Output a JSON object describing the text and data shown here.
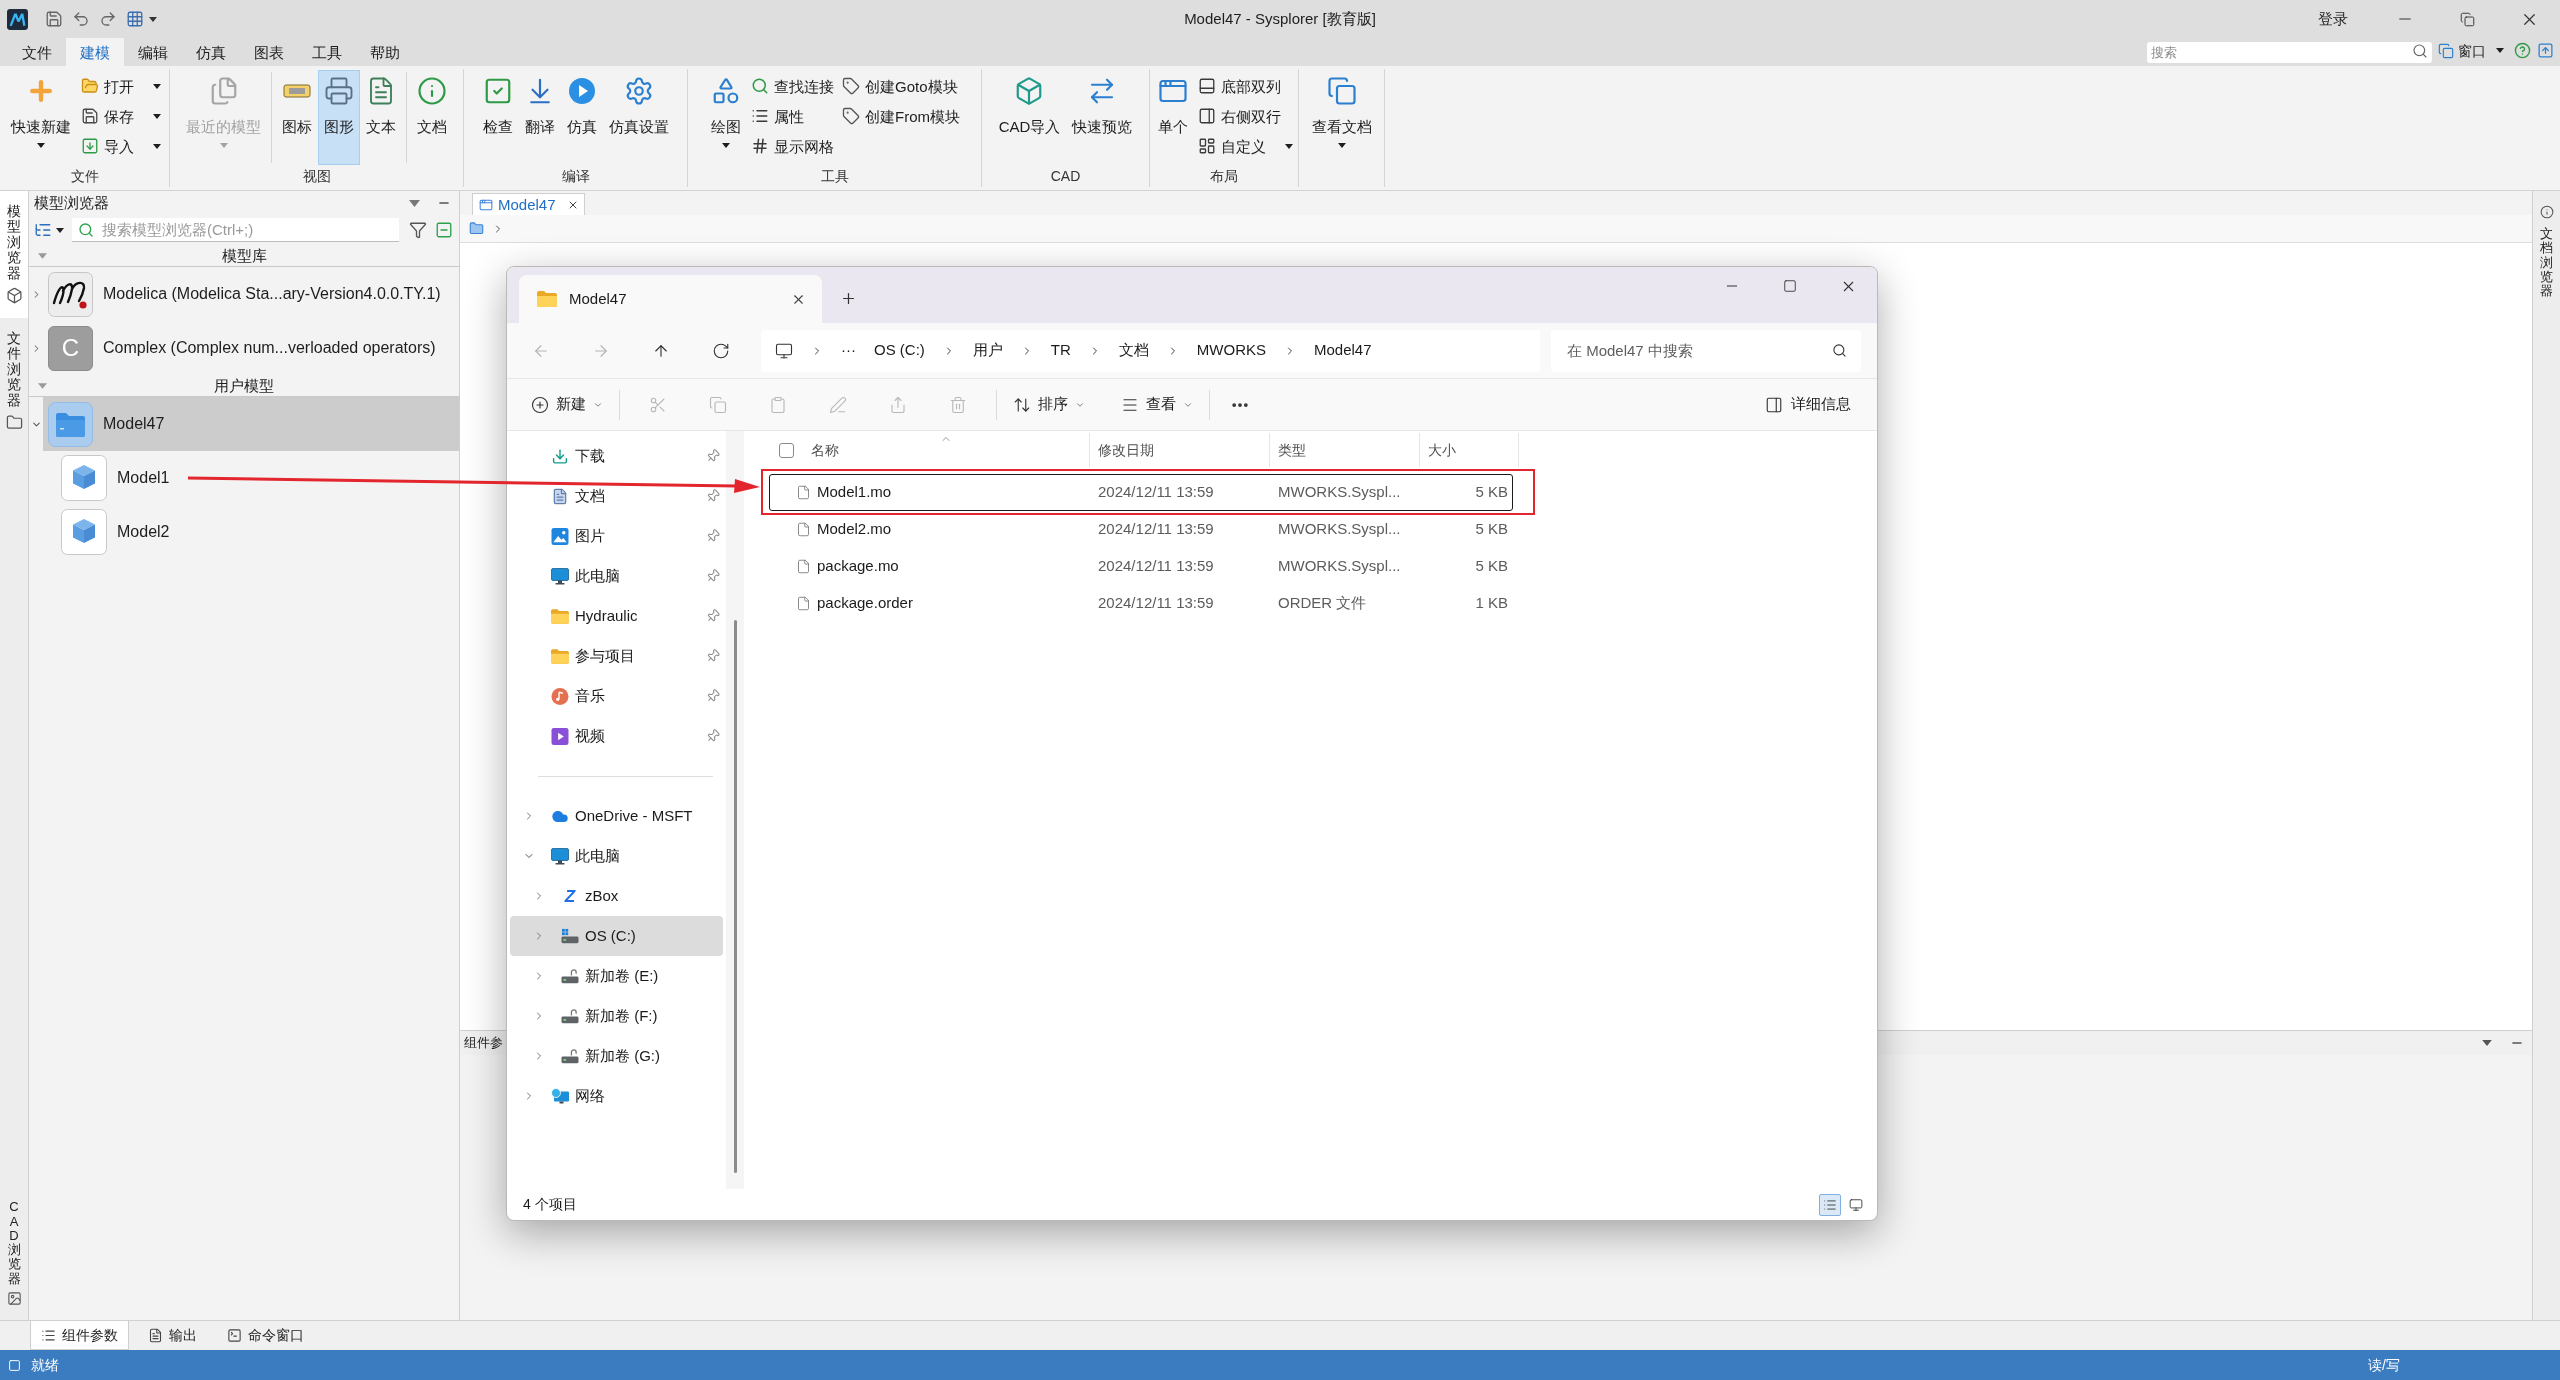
{
  "window": {
    "title": "Model47 - Sysplorer [教育版]",
    "account": "登录"
  },
  "menu_tabs": [
    {
      "label": "文件",
      "selected": false
    },
    {
      "label": "建模",
      "selected": true
    },
    {
      "label": "编辑",
      "selected": false
    },
    {
      "label": "仿真",
      "selected": false
    },
    {
      "label": "图表",
      "selected": false
    },
    {
      "label": "工具",
      "selected": false
    },
    {
      "label": "帮助",
      "selected": false
    }
  ],
  "global_search": {
    "placeholder": "搜索"
  },
  "window_menu": {
    "label": "窗口",
    "dropdown": true
  },
  "ribbon": [
    {
      "label": "文件",
      "sections": [
        [
          {
            "kind": "large",
            "label": "快速新建",
            "dropdown": true,
            "selected": false,
            "disabled": false
          },
          {
            "kind": "stack",
            "items": [
              {
                "label": "打开",
                "dropdown": true
              },
              {
                "label": "保存",
                "dropdown": true
              },
              {
                "label": "导入",
                "dropdown": true
              }
            ]
          }
        ]
      ]
    },
    {
      "label": "视图",
      "sections": [
        [
          {
            "kind": "large",
            "label": "最近的模型",
            "dropdown": true,
            "selected": false,
            "disabled": true
          }
        ],
        [
          {
            "kind": "large",
            "label": "图标",
            "dropdown": false,
            "selected": false,
            "disabled": false
          },
          {
            "kind": "large",
            "label": "图形",
            "dropdown": false,
            "selected": true,
            "disabled": false
          },
          {
            "kind": "large",
            "label": "文本",
            "dropdown": false,
            "selected": false,
            "disabled": false
          }
        ],
        [
          {
            "kind": "large",
            "label": "文档",
            "dropdown": false,
            "selected": false,
            "disabled": false
          }
        ]
      ]
    },
    {
      "label": "编译",
      "sections": [
        [
          {
            "kind": "large",
            "label": "检查",
            "dropdown": false,
            "selected": false,
            "disabled": false
          },
          {
            "kind": "large",
            "label": "翻译",
            "dropdown": false,
            "selected": false,
            "disabled": false
          },
          {
            "kind": "large",
            "label": "仿真",
            "dropdown": false,
            "selected": false,
            "disabled": false
          },
          {
            "kind": "large",
            "label": "仿真设置",
            "dropdown": false,
            "selected": false,
            "disabled": false
          }
        ]
      ]
    },
    {
      "label": "工具",
      "sections": [
        [
          {
            "kind": "large",
            "label": "绘图",
            "dropdown": true,
            "selected": false,
            "disabled": false
          },
          {
            "kind": "stack",
            "items": [
              {
                "label": "查找连接",
                "dropdown": false
              },
              {
                "label": "属性",
                "dropdown": false
              },
              {
                "label": "显示网格",
                "dropdown": false
              }
            ]
          },
          {
            "kind": "stack",
            "items": [
              {
                "label": "创建Goto模块",
                "dropdown": false
              },
              {
                "label": "创建From模块",
                "dropdown": false
              }
            ]
          }
        ]
      ]
    },
    {
      "label": "CAD",
      "sections": [
        [
          {
            "kind": "large",
            "label": "CAD导入",
            "dropdown": false,
            "selected": false,
            "disabled": false
          },
          {
            "kind": "large",
            "label": "快速预览",
            "dropdown": false,
            "selected": false,
            "disabled": false
          }
        ]
      ]
    },
    {
      "label": "布局",
      "sections": [
        [
          {
            "kind": "large",
            "label": "单个",
            "dropdown": false,
            "selected": false,
            "disabled": false
          },
          {
            "kind": "stack",
            "items": [
              {
                "label": "底部双列",
                "dropdown": false
              },
              {
                "label": "右侧双行",
                "dropdown": false
              },
              {
                "label": "自定义",
                "dropdown": true
              }
            ]
          }
        ]
      ]
    },
    {
      "sections": [
        [
          {
            "kind": "large",
            "label": "查看文档",
            "dropdown": true,
            "selected": false,
            "disabled": false
          }
        ]
      ]
    }
  ],
  "side_tabs": [
    {
      "label": "模型浏览器",
      "selected": true
    },
    {
      "label": "文件浏览器",
      "selected": false
    }
  ],
  "bottom_side_tabs": [
    {
      "label": "CAD 浏览器",
      "selected": false
    }
  ],
  "model_browser": {
    "title": "模型浏览器",
    "search": {
      "placeholder": "搜索模型浏览器(Ctrl+;)"
    },
    "sections": [
      {
        "title": "模型库",
        "expanded": true,
        "items": [
          {
            "kind": "library",
            "label": "Modelica (Modelica Sta...ary-Version4.0.0.TY.1)",
            "expanded": false,
            "selected": false
          },
          {
            "kind": "library",
            "label": "Complex (Complex num...verloaded operators)",
            "icon_letter": "C",
            "expanded": false,
            "selected": false
          }
        ]
      },
      {
        "title": "用户模型",
        "expanded": true,
        "items": [
          {
            "kind": "package",
            "label": "Model47",
            "expanded": true,
            "selected": true,
            "children": [
              {
                "kind": "model",
                "label": "Model1",
                "selected": false
              },
              {
                "kind": "model",
                "label": "Model2",
                "selected": false
              }
            ]
          }
        ]
      }
    ]
  },
  "document_tabs": [
    {
      "label": "Model47",
      "selected": true
    }
  ],
  "component_panel": {
    "title": "组件参"
  },
  "right_side_tabs": [
    {
      "label": "文档浏览器",
      "selected": false
    }
  ],
  "bottom_tabs": [
    {
      "label": "组件参数",
      "selected": true
    },
    {
      "label": "输出",
      "selected": false
    },
    {
      "label": "命令窗口",
      "selected": false
    }
  ],
  "status_bar": {
    "message": "就绪",
    "mode": "读/写"
  },
  "explorer": {
    "tabs": [
      {
        "label": "Model47",
        "selected": true
      }
    ],
    "nav_buttons": [
      {
        "disabled": true
      },
      {
        "disabled": true
      },
      {
        "disabled": false
      },
      {
        "disabled": false
      }
    ],
    "address": {
      "overflow": "···",
      "parts": [
        "OS (C:)",
        "用户",
        "TR",
        "文档",
        "MWORKS",
        "Model47"
      ]
    },
    "search": {
      "placeholder": "在 Model47 中搜索"
    },
    "commands": [
      {
        "kind": "menu",
        "label": "新建",
        "dropdown": true
      },
      {
        "kind": "icon",
        "disabled": true
      },
      {
        "kind": "icon",
        "disabled": true
      },
      {
        "kind": "icon",
        "disabled": true
      },
      {
        "kind": "icon",
        "disabled": true
      },
      {
        "kind": "icon",
        "disabled": true
      },
      {
        "kind": "icon",
        "disabled": true
      },
      {
        "kind": "menu",
        "label": "排序",
        "dropdown": true
      },
      {
        "kind": "menu",
        "label": "查看",
        "dropdown": true
      },
      {
        "kind": "more"
      }
    ],
    "details_button": {
      "label": "详细信息"
    },
    "quick_access": [
      {
        "label": "下载",
        "pinned": true
      },
      {
        "label": "文档",
        "pinned": true
      },
      {
        "label": "图片",
        "pinned": true
      },
      {
        "label": "此电脑",
        "pinned": true
      },
      {
        "label": "Hydraulic",
        "pinned": true
      },
      {
        "label": "参与项目",
        "pinned": true
      },
      {
        "label": "音乐",
        "pinned": true
      },
      {
        "label": "视频",
        "pinned": true
      }
    ],
    "tree": [
      {
        "label": "OneDrive - MSFT",
        "expanded": false,
        "selected": false
      },
      {
        "label": "此电脑",
        "expanded": true,
        "selected": false,
        "children": [
          {
            "label": "zBox",
            "icon_letter": "Z",
            "expanded": false,
            "selected": false
          },
          {
            "label": "OS (C:)",
            "expanded": false,
            "selected": true
          },
          {
            "label": "新加卷 (E:)",
            "expanded": false,
            "selected": false
          },
          {
            "label": "新加卷 (F:)",
            "expanded": false,
            "selected": false
          },
          {
            "label": "新加卷 (G:)",
            "expanded": false,
            "selected": false
          }
        ]
      },
      {
        "label": "网络",
        "expanded": false,
        "selected": false
      }
    ],
    "select_all": {
      "checked": false
    },
    "columns": [
      {
        "label": "名称",
        "sorted": true
      },
      {
        "label": "修改日期",
        "sorted": false
      },
      {
        "label": "类型",
        "sorted": false
      },
      {
        "label": "大小",
        "sorted": false
      }
    ],
    "files": [
      {
        "name": "Model1.mo",
        "modified": "2024/12/11 13:59",
        "type": "MWORKS.Syspl...",
        "size": "5 KB",
        "focused": true,
        "selected": false
      },
      {
        "name": "Model2.mo",
        "modified": "2024/12/11 13:59",
        "type": "MWORKS.Syspl...",
        "size": "5 KB",
        "focused": false,
        "selected": false
      },
      {
        "name": "package.mo",
        "modified": "2024/12/11 13:59",
        "type": "MWORKS.Syspl...",
        "size": "5 KB",
        "focused": false,
        "selected": false
      },
      {
        "name": "package.order",
        "modified": "2024/12/11 13:59",
        "type": "ORDER 文件",
        "size": "1 KB",
        "focused": false,
        "selected": false
      }
    ],
    "status": "4 个项目",
    "view_modes": [
      {
        "selected": true
      },
      {
        "selected": false
      }
    ]
  }
}
